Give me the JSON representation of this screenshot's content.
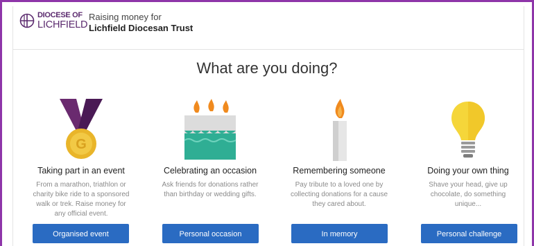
{
  "header": {
    "logo_line1": "DIOCESE OF",
    "logo_line2": "LICHFIELD",
    "raising_label": "Raising money for",
    "organisation": "Lichfield Diocesan Trust"
  },
  "main": {
    "heading": "What are you doing?",
    "cards": [
      {
        "title": "Taking part in an event",
        "description": "From a marathon, triathlon or charity bike ride to a sponsored walk or trek. Raise money for any official event.",
        "button": "Organised event",
        "icon": "medal-icon"
      },
      {
        "title": "Celebrating an occasion",
        "description": "Ask friends for donations rather than birthday or wedding gifts.",
        "button": "Personal occasion",
        "icon": "birthday-cake-icon"
      },
      {
        "title": "Remembering someone",
        "description": "Pay tribute to a loved one by collecting donations for a cause they cared about.",
        "button": "In memory",
        "icon": "candle-icon"
      },
      {
        "title": "Doing your own thing",
        "description": "Shave your head, give up chocolate, do something unique...",
        "button": "Personal challenge",
        "icon": "lightbulb-icon"
      }
    ]
  },
  "colors": {
    "frame": "#8e35a9",
    "button": "#2a6bc2",
    "logo": "#5b2a6e"
  }
}
